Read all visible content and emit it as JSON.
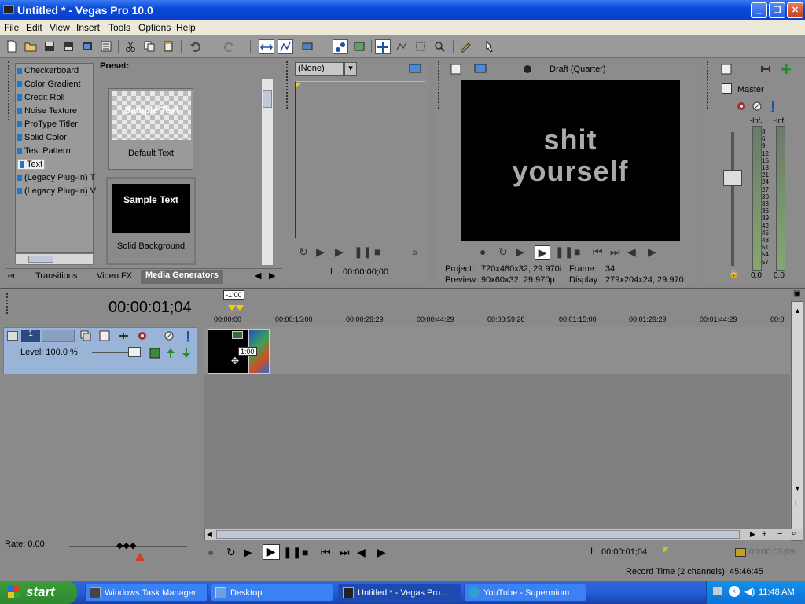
{
  "window": {
    "title": "Untitled * - Vegas Pro 10.0",
    "minimize": "_",
    "maximize": "❐",
    "close": "✕"
  },
  "menu": [
    "File",
    "Edit",
    "View",
    "Insert",
    "Tools",
    "Options",
    "Help"
  ],
  "generators": {
    "items": [
      "Checkerboard",
      "Color Gradient",
      "Credit Roll",
      "Noise Texture",
      "ProType Titler",
      "Solid Color",
      "Test Pattern",
      "Text",
      "(Legacy Plug-In) T",
      "(Legacy Plug-In) V"
    ],
    "selected_index": 7,
    "preset_label": "Preset:",
    "presets": [
      {
        "thumb_text": "Sample Text",
        "name": "Default Text",
        "style": "checker"
      },
      {
        "thumb_text": "Sample Text",
        "name": "Solid Background",
        "style": "black"
      }
    ],
    "tabs": [
      "er",
      "Transitions",
      "Video FX",
      "Media Generators"
    ],
    "active_tab": "Media Generators"
  },
  "trimmer": {
    "select_value": "(None)",
    "time": "00:00:00;00"
  },
  "preview": {
    "quality": "Draft (Quarter)",
    "overlay_text_line1": "shit",
    "overlay_text_line2": "yourself",
    "project_label": "Project:",
    "project_value": "720x480x32, 29.970i",
    "frame_label": "Frame:",
    "frame_value": "34",
    "preview_label": "Preview:",
    "preview_value": "90x60x32, 29.970p",
    "display_label": "Display:",
    "display_value": "279x204x24, 29.970"
  },
  "master": {
    "label": "Master",
    "left_peak": "-Inf.",
    "right_peak": "-Inf.",
    "scale": [
      "3",
      "6",
      "9",
      "12",
      "15",
      "18",
      "21",
      "24",
      "27",
      "30",
      "33",
      "36",
      "39",
      "42",
      "45",
      "48",
      "51",
      "54",
      "57"
    ],
    "left_value": "0.0",
    "right_value": "0.0"
  },
  "timeline": {
    "position": "00:00:01;04",
    "loop_marker": "-1:00",
    "ruler": [
      "00:00:00",
      "00:00:15;00",
      "00:00:29;29",
      "00:00:44;29",
      "00:00:59;28",
      "00:01:15;00",
      "00:01:29;29",
      "00:01:44;29",
      "00:0"
    ],
    "track_level": "Level: 100.0 %",
    "clip_tooltip": "1:00",
    "rate": "Rate: 0.00",
    "transport_pos": "00:00:01;04",
    "end_time": "00:00:05;09",
    "record_time": "Record Time (2 channels): 45:46:45"
  },
  "taskbar": {
    "start": "start",
    "tasks": [
      {
        "label": "Windows Task Manager",
        "active": false
      },
      {
        "label": "Desktop",
        "active": false
      },
      {
        "label": "Untitled * - Vegas Pro...",
        "active": true
      },
      {
        "label": "YouTube - Supermium",
        "active": false
      }
    ],
    "clock": "11:48 AM"
  },
  "colors": {
    "titlebar": "#0a4ad8",
    "panel_bg": "#8c8c8c",
    "track_header": "#9ab4d8",
    "taskbar": "#245edb",
    "start_green": "#3c9a3c"
  }
}
